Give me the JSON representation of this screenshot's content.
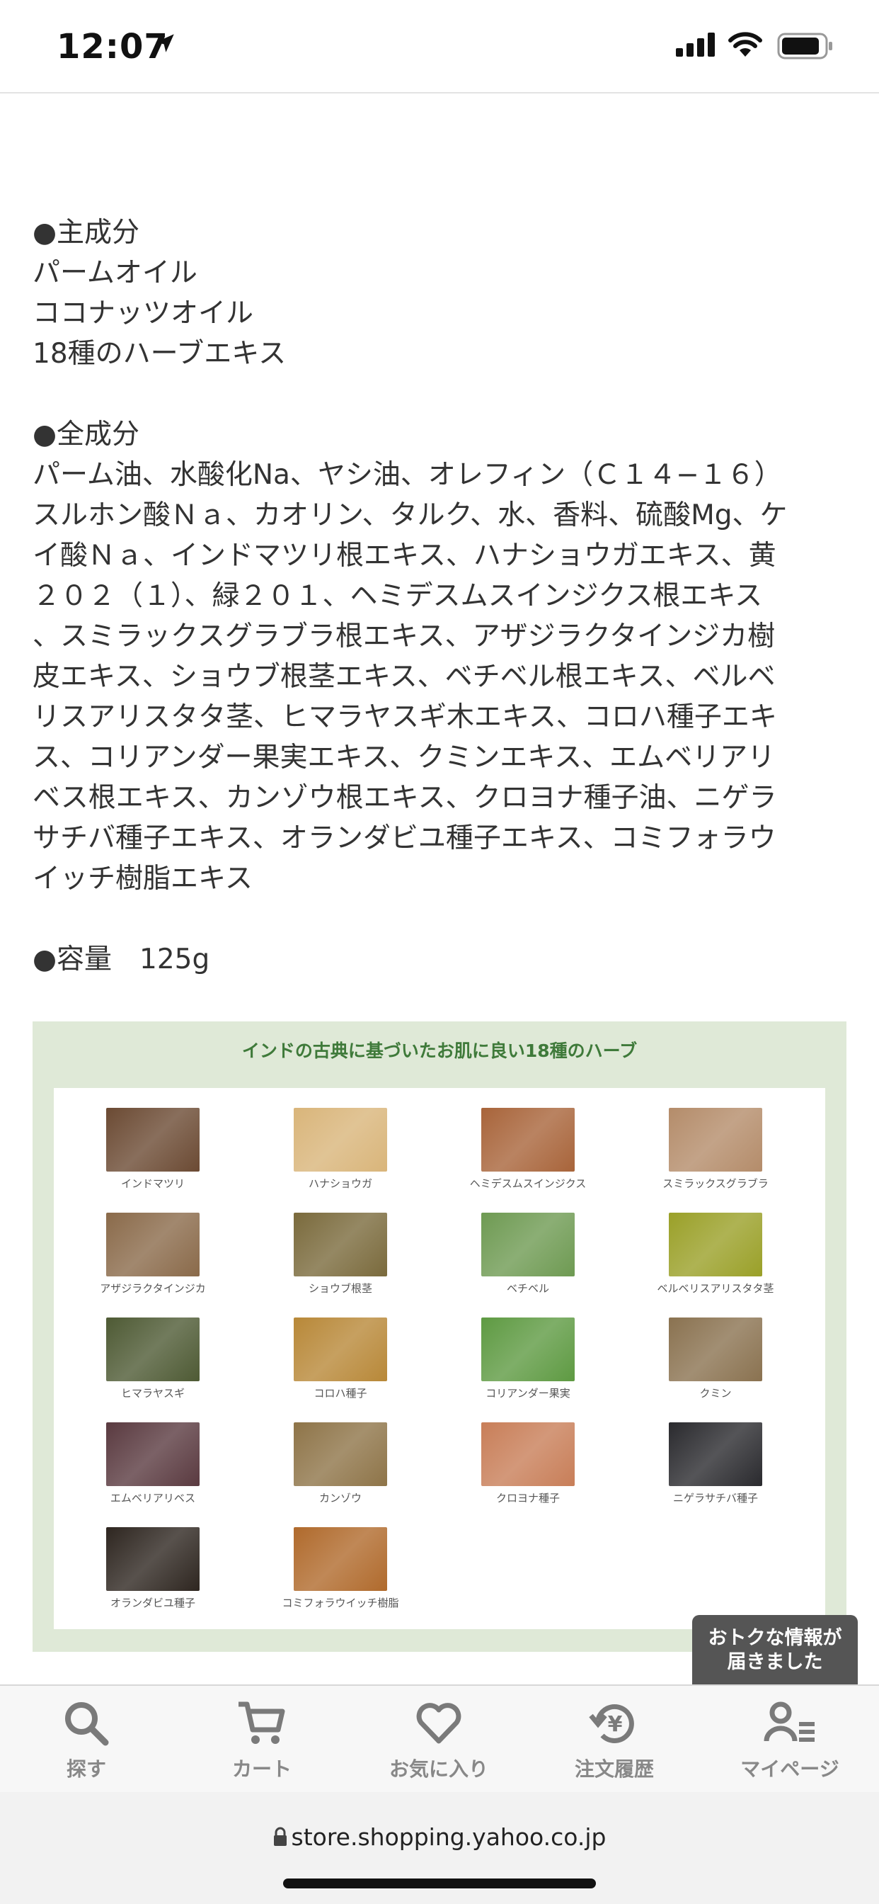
{
  "status_bar": {
    "time": "12:07"
  },
  "content": {
    "main_ingredients_heading": "●主成分",
    "main_ingredients": [
      "パームオイル",
      "ココナッツオイル",
      "18種のハーブエキス"
    ],
    "all_ingredients_heading": "●全成分",
    "all_ingredients_lines": [
      "パーム油、水酸化Na、ヤシ油、オレフィン（Ｃ１４−１６）",
      "スルホン酸Ｎａ、カオリン、タルク、水、香料、硫酸Mg、ケ",
      "イ酸Ｎａ、インドマツリ根エキス、ハナショウガエキス、黄",
      "２０２（１）、緑２０１、ヘミデスムスインジクス根エキス",
      "、スミラックスグラブラ根エキス、アザジラクタインジカ樹",
      "皮エキス、ショウブ根茎エキス、ベチベル根エキス、ベルベ",
      "リスアリスタタ茎、ヒマラヤスギ木エキス、コロハ種子エキ",
      "ス、コリアンダー果実エキス、クミンエキス、エムベリアリ",
      "ベス根エキス、カンゾウ根エキス、クロヨナ種子油、ニゲラ",
      "サチバ種子エキス、オランダビユ種子エキス、コミフォラウ",
      "イッチ樹脂エキス"
    ],
    "volume": "●容量　125g"
  },
  "herbs_panel": {
    "title": "インドの古典に基づいたお肌に良い18種のハーブ",
    "items": [
      {
        "label": "インドマツリ",
        "color": "#6b4a33"
      },
      {
        "label": "ハナショウガ",
        "color": "#d9b57a"
      },
      {
        "label": "ヘミデスムスインジクス",
        "color": "#a8643a"
      },
      {
        "label": "スミラックスグラブラ",
        "color": "#b48c6a"
      },
      {
        "label": "アザジラクタインジカ",
        "color": "#8a6a4a"
      },
      {
        "label": "ショウブ根茎",
        "color": "#7a6a3c"
      },
      {
        "label": "ベチベル",
        "color": "#6e9a52"
      },
      {
        "label": "ベルベリスアリスタタ茎",
        "color": "#9aa028"
      },
      {
        "label": "ヒマラヤスギ",
        "color": "#4e5a34"
      },
      {
        "label": "コロハ種子",
        "color": "#b88838"
      },
      {
        "label": "コリアンダー果実",
        "color": "#5e9a42"
      },
      {
        "label": "クミン",
        "color": "#8a7250"
      },
      {
        "label": "エムベリアリベス",
        "color": "#5a3a40"
      },
      {
        "label": "カンゾウ",
        "color": "#8e7448"
      },
      {
        "label": "クロヨナ種子",
        "color": "#c87e58"
      },
      {
        "label": "ニゲラサチバ種子",
        "color": "#2a2a2e"
      },
      {
        "label": "オランダビユ種子",
        "color": "#2e2620"
      },
      {
        "label": "コミフォラウイッチ樹脂",
        "color": "#b06a2c"
      }
    ]
  },
  "toast": {
    "line1": "おトクな情報が",
    "line2": "届きました"
  },
  "tabbar": {
    "tabs": [
      {
        "label": "探す",
        "icon": "search-icon"
      },
      {
        "label": "カート",
        "icon": "cart-icon"
      },
      {
        "label": "お気に入り",
        "icon": "heart-icon"
      },
      {
        "label": "注文履歴",
        "icon": "order-history-icon"
      },
      {
        "label": "マイページ",
        "icon": "user-icon"
      }
    ]
  },
  "browser": {
    "url": "store.shopping.yahoo.co.jp"
  }
}
